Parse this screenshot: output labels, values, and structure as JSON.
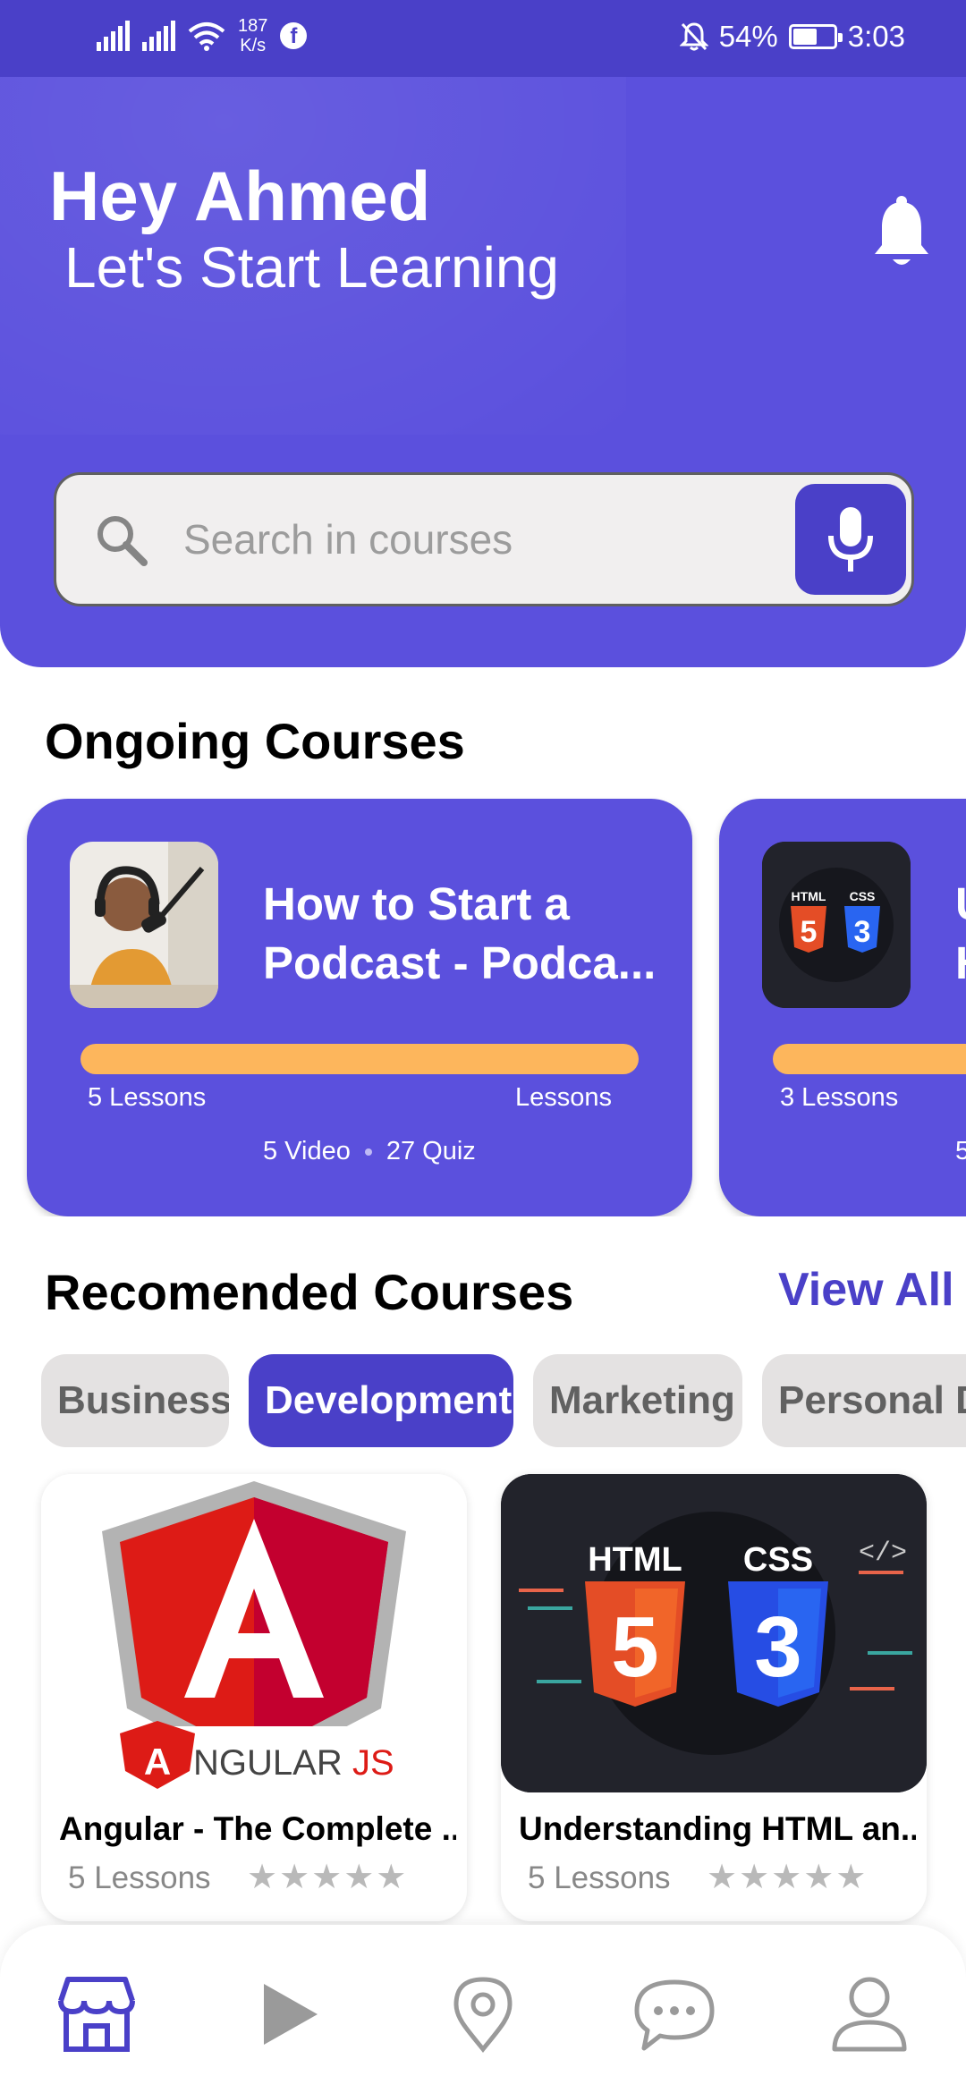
{
  "status_bar": {
    "network_speed_value": "187",
    "network_speed_unit": "K/s",
    "battery_percent": "54%",
    "battery_level": 0.54,
    "time": "3:03"
  },
  "header": {
    "greeting": "Hey Ahmed",
    "subtitle": "Let's Start Learning",
    "bell_icon": "bell-icon"
  },
  "search": {
    "placeholder": "Search in courses",
    "value": "",
    "search_icon": "search-icon",
    "mic_icon": "mic-icon"
  },
  "ongoing": {
    "title": "Ongoing Courses",
    "courses": [
      {
        "title_line1": "How to Start a",
        "title_line2": "Podcast - Podca...",
        "lessons_left": "5 Lessons",
        "lessons_right": "Lessons",
        "videos": "5 Video",
        "quizzes": "27 Quiz"
      },
      {
        "title_line1": "U",
        "title_line2": "H",
        "lessons_left": "3 Lessons",
        "lessons_right": "",
        "videos": "5",
        "quizzes": ""
      }
    ]
  },
  "recommended": {
    "title": "Recomended Courses",
    "view_all": "View All",
    "categories": [
      {
        "label": "Business",
        "active": false
      },
      {
        "label": "Development",
        "active": true
      },
      {
        "label": "Marketing",
        "active": false
      },
      {
        "label": "Personal D",
        "active": false
      }
    ],
    "courses": [
      {
        "title": "Angular - The Complete ...",
        "lessons": "5 Lessons",
        "stars": "★★★★★",
        "logo_text_a": "A",
        "logo_text_rest": "NGULAR",
        "logo_text_js": "JS"
      },
      {
        "title": "Understanding HTML an...",
        "lessons": "5 Lessons",
        "stars": "★★★★★",
        "badge_html": "HTML",
        "badge_css": "CSS",
        "badge_5": "5",
        "badge_3": "3"
      }
    ]
  },
  "bottom_nav": {
    "items": [
      {
        "icon": "store-icon",
        "active": true
      },
      {
        "icon": "play-icon",
        "active": false
      },
      {
        "icon": "location-icon",
        "active": false
      },
      {
        "icon": "chat-icon",
        "active": false
      },
      {
        "icon": "profile-icon",
        "active": false
      }
    ]
  },
  "colors": {
    "primary": "#5b50dd",
    "primary_dark": "#4a40c8",
    "progress": "#fdb65c",
    "chip_inactive": "#e4e2e2"
  }
}
